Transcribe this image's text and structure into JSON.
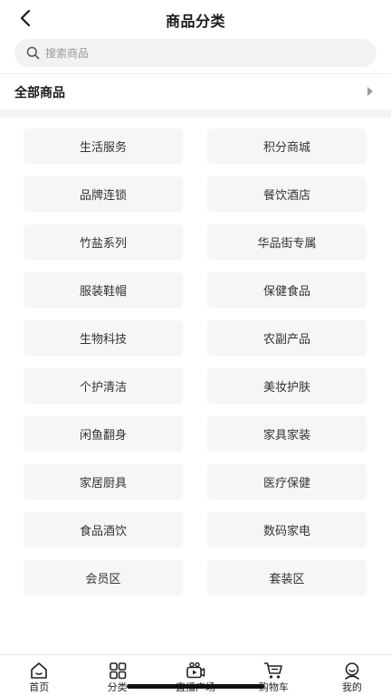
{
  "header": {
    "title": "商品分类"
  },
  "search": {
    "placeholder": "搜索商品"
  },
  "all_goods": {
    "label": "全部商品"
  },
  "categories": [
    "生活服务",
    "积分商城",
    "品牌连锁",
    "餐饮酒店",
    "竹盐系列",
    "华品街专属",
    "服装鞋帽",
    "保健食品",
    "生物科技",
    "农副产品",
    "个护清洁",
    "美妆护肤",
    "闲鱼翻身",
    "家具家装",
    "家居厨具",
    "医疗保健",
    "食品酒饮",
    "数码家电",
    "会员区",
    "套装区"
  ],
  "tabbar": {
    "items": [
      {
        "label": "首页",
        "icon": "home-icon"
      },
      {
        "label": "分类",
        "icon": "grid-icon"
      },
      {
        "label": "直播广场",
        "icon": "live-camera-icon"
      },
      {
        "label": "购物车",
        "icon": "cart-icon"
      },
      {
        "label": "我的",
        "icon": "profile-icon"
      }
    ]
  }
}
